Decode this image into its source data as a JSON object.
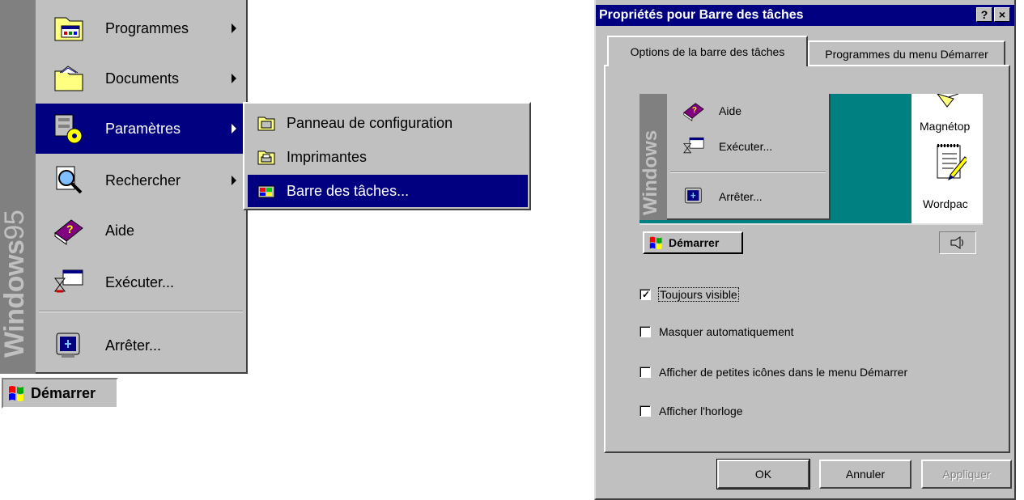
{
  "start_menu": {
    "brand": {
      "bold": "Windows",
      "light": "95"
    },
    "items": [
      {
        "label": "Programmes",
        "icon": "programs-folder-icon",
        "has_submenu": true
      },
      {
        "label": "Documents",
        "icon": "documents-folder-icon",
        "has_submenu": true
      },
      {
        "label": "Paramètres",
        "icon": "settings-icon",
        "has_submenu": true,
        "selected": true
      },
      {
        "label": "Rechercher",
        "icon": "find-icon",
        "has_submenu": true
      },
      {
        "label": "Aide",
        "icon": "help-book-icon",
        "has_submenu": false
      },
      {
        "label": "Exécuter...",
        "icon": "run-icon",
        "has_submenu": false
      },
      {
        "label": "Arrêter...",
        "icon": "shutdown-computer-icon",
        "has_submenu": false
      }
    ],
    "submenu": [
      {
        "label": "Panneau de configuration",
        "icon": "control-panel-icon"
      },
      {
        "label": "Imprimantes",
        "icon": "printers-icon"
      },
      {
        "label": "Barre des tâches...",
        "icon": "taskbar-icon",
        "selected": true
      }
    ],
    "start_button": "Démarrer"
  },
  "dialog": {
    "title": "Propriétés pour Barre des tâches",
    "help_button": "?",
    "close_button": "×",
    "tabs": [
      "Options de la barre des tâches",
      "Programmes du menu Démarrer"
    ],
    "active_tab": 0,
    "preview": {
      "brand": "Windows",
      "menu_items": [
        "Aide",
        "Exécuter...",
        "Arrêter..."
      ],
      "desktop_icons": [
        "Magnétop",
        "Wordpac"
      ],
      "start_button": "Démarrer"
    },
    "options": [
      {
        "label": "Toujours visible",
        "checked": true
      },
      {
        "label": "Masquer automatiquement",
        "checked": false
      },
      {
        "label": "Afficher de petites icônes dans le menu Démarrer",
        "checked": false
      },
      {
        "label": "Afficher l'horloge",
        "checked": false
      }
    ],
    "buttons": {
      "ok": "OK",
      "cancel": "Annuler",
      "apply": "Appliquer"
    }
  },
  "colors": {
    "menu_highlight": "#000080",
    "face": "#c0c0c0",
    "desktop": "#008080"
  }
}
